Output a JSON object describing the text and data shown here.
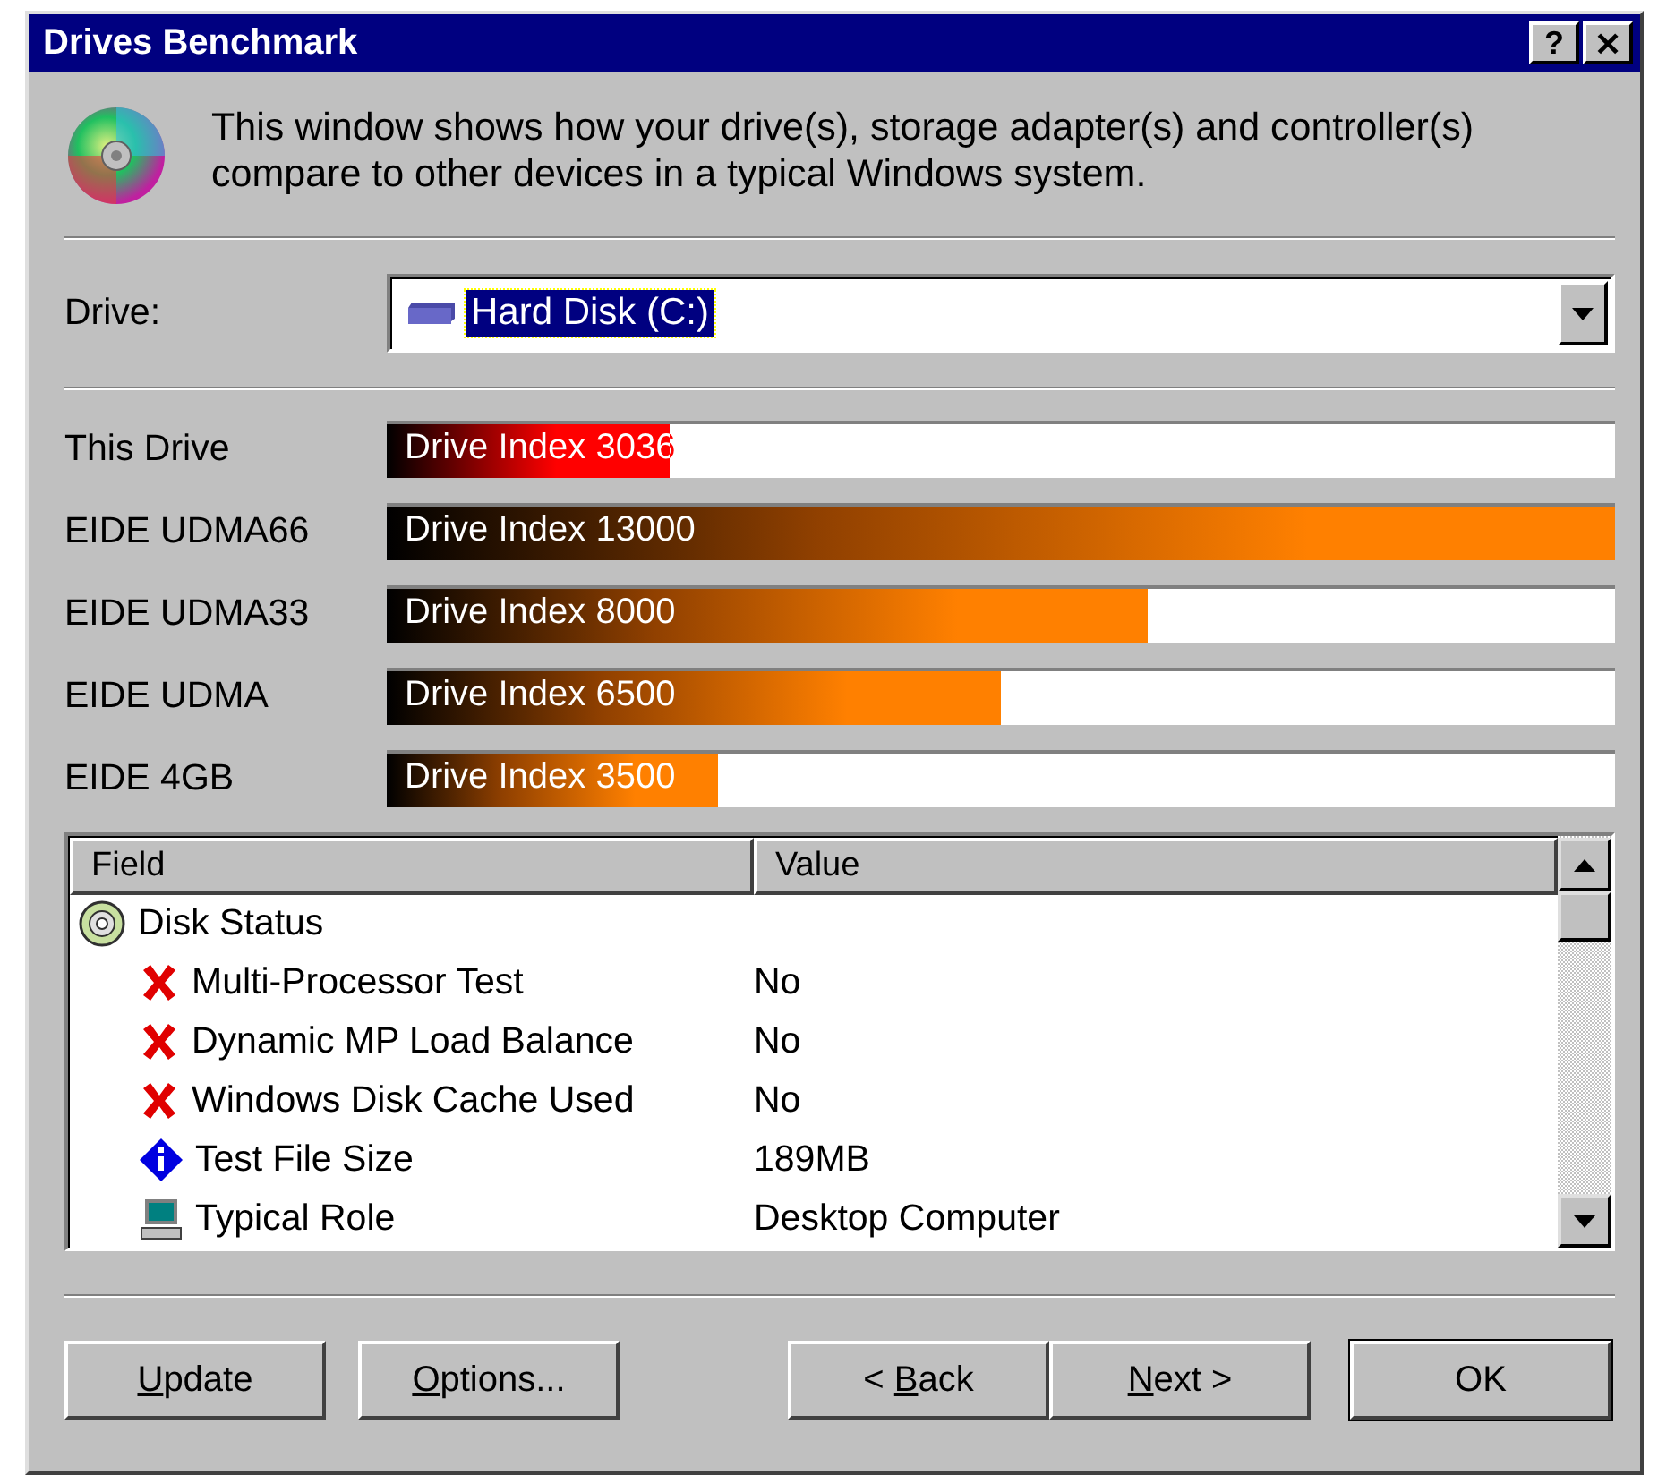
{
  "window": {
    "title": "Drives Benchmark",
    "title_buttons": [
      "?",
      "✕"
    ]
  },
  "description": "This window shows how your drive(s), storage adapter(s) and controller(s) compare to other devices in a typical Windows system.",
  "drive": {
    "label": "Drive:",
    "value": "Hard Disk (C:)"
  },
  "benchmarks": [
    {
      "name": "This Drive",
      "bar_text": "Drive Index 3036",
      "level": 0.23,
      "kind": "current"
    },
    {
      "name": "EIDE UDMA66",
      "bar_text": "Drive Index 13000",
      "level": 1.0,
      "kind": "reference"
    },
    {
      "name": "EIDE UDMA33",
      "bar_text": "Drive Index 8000",
      "level": 0.62,
      "kind": "reference"
    },
    {
      "name": "EIDE UDMA",
      "bar_text": "Drive Index 6500",
      "level": 0.5,
      "kind": "reference"
    },
    {
      "name": "EIDE 4GB",
      "bar_text": "Drive Index 3500",
      "level": 0.27,
      "kind": "reference"
    }
  ],
  "table": {
    "columns": [
      "Field",
      "Value"
    ],
    "rows": [
      {
        "field": "Disk Status",
        "kind": "disk",
        "children": [
          {
            "field": "Multi-Processor Test",
            "value": "No",
            "kind": "cross"
          },
          {
            "field": "Dynamic MP Load Balance",
            "value": "No",
            "kind": "cross"
          },
          {
            "field": "Windows Disk Cache Used",
            "value": "No",
            "kind": "cross"
          },
          {
            "field": "Test File Size",
            "value": "189MB",
            "kind": "info"
          },
          {
            "field": "Typical Role",
            "value": "Desktop Computer",
            "kind": "computer"
          }
        ]
      }
    ]
  },
  "buttons": [
    {
      "key": "U",
      "after": "pdate",
      "kind": "action",
      "default": false
    },
    {
      "key": "O",
      "after": "ptions...",
      "kind": "action",
      "default": false
    },
    {
      "before": "< ",
      "key": "B",
      "after": "ack",
      "kind": "nav",
      "default": false
    },
    {
      "key": "N",
      "after": "ext >",
      "kind": "nav",
      "default": false
    },
    {
      "after": "OK",
      "kind": "confirm",
      "default": true
    }
  ]
}
